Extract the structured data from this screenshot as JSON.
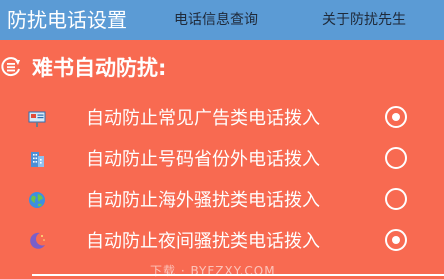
{
  "tabs": [
    {
      "label": "防扰电话设置",
      "active": true
    },
    {
      "label": "电话信息查询",
      "active": false
    },
    {
      "label": "关于防扰先生",
      "active": false
    }
  ],
  "section": {
    "title": "难书自动防扰:",
    "icon": "refresh-list-icon"
  },
  "options": [
    {
      "label": "自动防止常见广告类电话拨入",
      "icon": "billboard-icon",
      "checked": true
    },
    {
      "label": "自动防止号码省份外电话拨入",
      "icon": "building-icon",
      "checked": false
    },
    {
      "label": "自动防止海外骚扰类电话拨入",
      "icon": "globe-icon",
      "checked": false
    },
    {
      "label": "自动防止夜间骚扰类电话拨入",
      "icon": "moon-icon",
      "checked": true
    }
  ],
  "watermark": "下载 · BYFZXY.COM",
  "colors": {
    "background": "#f86a51",
    "tabbar": "#5b9bd5",
    "text": "#ffffff"
  }
}
